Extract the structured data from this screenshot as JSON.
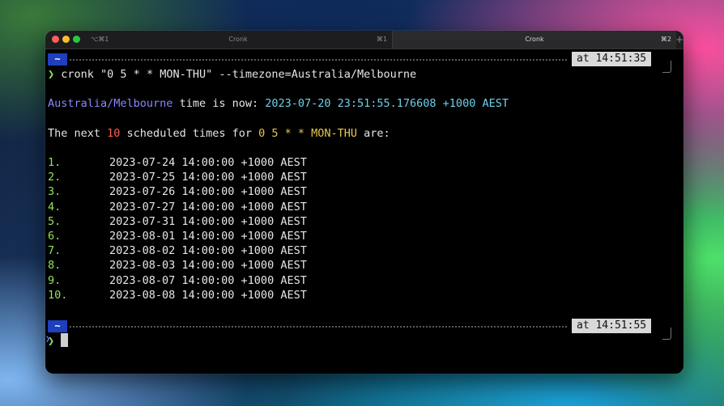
{
  "window": {
    "tabs": [
      {
        "shortcut_left": "⌥⌘1",
        "title": "Cronk",
        "shortcut_right": "⌘1",
        "active": false
      },
      {
        "shortcut_left": "",
        "title": "Cronk",
        "shortcut_right": "⌘2",
        "active": true
      }
    ],
    "new_tab_label": "+"
  },
  "prompt_block_1": {
    "dir": "~",
    "time": "at 14:51:35",
    "prompt_symbol": "❯",
    "command": "cronk \"0 5 * * MON-THU\" --timezone=Australia/Melbourne"
  },
  "output": {
    "tz_name": "Australia/Melbourne",
    "tz_mid": " time is now: ",
    "tz_now": "2023-07-20 23:51:55.176608 +1000 AEST",
    "next_prefix": "The next ",
    "next_count": "10",
    "next_mid": " scheduled times for ",
    "next_expr": "0 5 * * MON-THU",
    "next_suffix": " are:",
    "times": [
      {
        "idx": "1.",
        "value": "2023-07-24 14:00:00 +1000 AEST"
      },
      {
        "idx": "2.",
        "value": "2023-07-25 14:00:00 +1000 AEST"
      },
      {
        "idx": "3.",
        "value": "2023-07-26 14:00:00 +1000 AEST"
      },
      {
        "idx": "4.",
        "value": "2023-07-27 14:00:00 +1000 AEST"
      },
      {
        "idx": "5.",
        "value": "2023-07-31 14:00:00 +1000 AEST"
      },
      {
        "idx": "6.",
        "value": "2023-08-01 14:00:00 +1000 AEST"
      },
      {
        "idx": "7.",
        "value": "2023-08-02 14:00:00 +1000 AEST"
      },
      {
        "idx": "8.",
        "value": "2023-08-03 14:00:00 +1000 AEST"
      },
      {
        "idx": "9.",
        "value": "2023-08-07 14:00:00 +1000 AEST"
      },
      {
        "idx": "10.",
        "value": "2023-08-08 14:00:00 +1000 AEST"
      }
    ]
  },
  "prompt_block_2": {
    "dir": "~",
    "time": "at 14:51:55",
    "prompt_symbol": "❯"
  },
  "colors": {
    "accent_green": "#8ee65a",
    "accent_blue": "#8a86ff",
    "accent_cyan": "#6fd0e8",
    "accent_red": "#ff5f4a",
    "accent_yellow": "#e6c84a",
    "dir_badge": "#1f3fbf"
  }
}
